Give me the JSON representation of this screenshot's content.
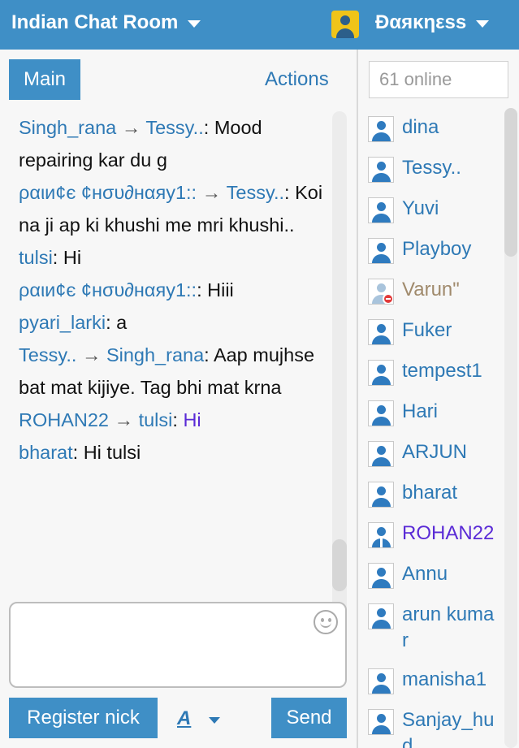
{
  "header": {
    "room_title": "Indian Chat Room",
    "username": "Ðαяκηεss",
    "accent_color": "#3f8fc6"
  },
  "tabs": {
    "main": "Main",
    "actions": "Actions"
  },
  "messages": [
    {
      "from": "Singh_rana",
      "to": "Tessy..",
      "text": "Mood repairing kar du g"
    },
    {
      "from": "ραιи¢є ¢нσυ∂нαяу1::",
      "to": "Tessy..",
      "text": "Koi na ji ap ki khushi me mri khushi.."
    },
    {
      "from": "tulsi",
      "text": "Hi"
    },
    {
      "from": "ραιи¢є ¢нσυ∂нαяу1::",
      "text": "Hiii"
    },
    {
      "from": "pyari_larki",
      "text": "a"
    },
    {
      "from": "Tessy..",
      "to": "Singh_rana",
      "text": "Aap mujhse bat mat kijiye. Tag bhi mat krna"
    },
    {
      "from": "ROHAN22",
      "to": "tulsi",
      "text": "Hi"
    },
    {
      "from": "bharat",
      "text": "Hi tulsi"
    }
  ],
  "arrow_symbol": "→",
  "composer": {
    "register_label": "Register nick",
    "font_label": "A",
    "send_label": "Send"
  },
  "online_count": "61 online",
  "users": [
    {
      "name": "dina",
      "status": "normal"
    },
    {
      "name": "Tessy..",
      "status": "normal"
    },
    {
      "name": "Yuvi",
      "status": "normal"
    },
    {
      "name": "Playboy",
      "status": "normal"
    },
    {
      "name": "Varun\"",
      "status": "away"
    },
    {
      "name": "Fuker",
      "status": "normal"
    },
    {
      "name": "tempest1",
      "status": "normal"
    },
    {
      "name": "Hari",
      "status": "normal"
    },
    {
      "name": "ARJUN",
      "status": "normal"
    },
    {
      "name": "bharat",
      "status": "normal"
    },
    {
      "name": "ROHAN22",
      "status": "staff"
    },
    {
      "name": "Annu",
      "status": "normal"
    },
    {
      "name": "arun kumar",
      "status": "normal"
    },
    {
      "name": "manisha1",
      "status": "normal"
    },
    {
      "name": "Sanjay_hud",
      "status": "normal"
    }
  ]
}
